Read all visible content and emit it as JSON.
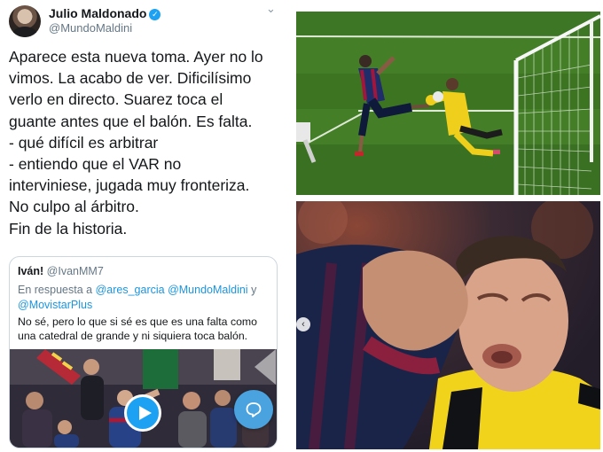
{
  "tweet": {
    "author_name": "Julio Maldonado",
    "handle": "@MundoMaldini",
    "body_lines": [
      "Aparece esta nueva toma. Ayer no lo",
      "vimos. La acabo de ver. Dificilísimo",
      "verlo en directo. Suarez toca el",
      "guante antes que el balón. Es falta.",
      "- qué difícil es arbitrar",
      "- entiendo que el VAR no",
      "interviniese, jugada muy fronteriza.",
      "No culpo al árbitro.",
      "Fin de la historia."
    ]
  },
  "quote": {
    "author_name": "Iván!",
    "handle": "@IvanMM7",
    "reply_prefix": "En respuesta a",
    "reply_to_1": "@ares_garcia",
    "reply_to_2": "@MundoMaldini",
    "reply_and": "y",
    "reply_to_3": "@MovistarPlus",
    "text_lines": [
      "No sé, pero lo que si sé es que es una falta como",
      "una catedral de grande y ni siquiera toca balón."
    ]
  },
  "icons": {
    "verified": "verified-badge-icon",
    "menu": "chevron-down-icon",
    "play": "play-icon",
    "reply": "reply-bubble-icon",
    "prev": "chevron-left-icon"
  },
  "colors": {
    "twitter_blue": "#1da1f2",
    "link_blue": "#1b95e0",
    "secondary_text": "#657786",
    "barca_blue": "#1f2d6b",
    "keeper_yellow": "#f1d21d",
    "pitch_green": "#3f7d24"
  }
}
